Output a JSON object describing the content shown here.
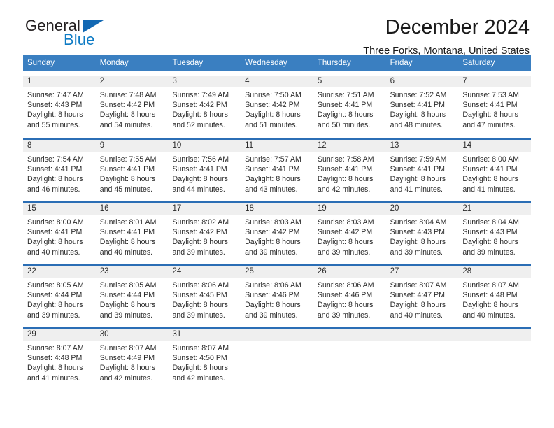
{
  "brand": {
    "name_top": "General",
    "name_bottom": "Blue",
    "accent_color": "#1268b3",
    "text_color": "#231f20"
  },
  "header": {
    "title": "December 2024",
    "subtitle": "Three Forks, Montana, United States"
  },
  "calendar": {
    "header_bg": "#3a7fc1",
    "row_border": "#2b6eb5",
    "daynum_bg": "#efefef",
    "weekdays": [
      "Sunday",
      "Monday",
      "Tuesday",
      "Wednesday",
      "Thursday",
      "Friday",
      "Saturday"
    ],
    "weeks": [
      [
        {
          "day": "1",
          "sunrise": "Sunrise: 7:47 AM",
          "sunset": "Sunset: 4:43 PM",
          "daylight1": "Daylight: 8 hours",
          "daylight2": "and 55 minutes."
        },
        {
          "day": "2",
          "sunrise": "Sunrise: 7:48 AM",
          "sunset": "Sunset: 4:42 PM",
          "daylight1": "Daylight: 8 hours",
          "daylight2": "and 54 minutes."
        },
        {
          "day": "3",
          "sunrise": "Sunrise: 7:49 AM",
          "sunset": "Sunset: 4:42 PM",
          "daylight1": "Daylight: 8 hours",
          "daylight2": "and 52 minutes."
        },
        {
          "day": "4",
          "sunrise": "Sunrise: 7:50 AM",
          "sunset": "Sunset: 4:42 PM",
          "daylight1": "Daylight: 8 hours",
          "daylight2": "and 51 minutes."
        },
        {
          "day": "5",
          "sunrise": "Sunrise: 7:51 AM",
          "sunset": "Sunset: 4:41 PM",
          "daylight1": "Daylight: 8 hours",
          "daylight2": "and 50 minutes."
        },
        {
          "day": "6",
          "sunrise": "Sunrise: 7:52 AM",
          "sunset": "Sunset: 4:41 PM",
          "daylight1": "Daylight: 8 hours",
          "daylight2": "and 48 minutes."
        },
        {
          "day": "7",
          "sunrise": "Sunrise: 7:53 AM",
          "sunset": "Sunset: 4:41 PM",
          "daylight1": "Daylight: 8 hours",
          "daylight2": "and 47 minutes."
        }
      ],
      [
        {
          "day": "8",
          "sunrise": "Sunrise: 7:54 AM",
          "sunset": "Sunset: 4:41 PM",
          "daylight1": "Daylight: 8 hours",
          "daylight2": "and 46 minutes."
        },
        {
          "day": "9",
          "sunrise": "Sunrise: 7:55 AM",
          "sunset": "Sunset: 4:41 PM",
          "daylight1": "Daylight: 8 hours",
          "daylight2": "and 45 minutes."
        },
        {
          "day": "10",
          "sunrise": "Sunrise: 7:56 AM",
          "sunset": "Sunset: 4:41 PM",
          "daylight1": "Daylight: 8 hours",
          "daylight2": "and 44 minutes."
        },
        {
          "day": "11",
          "sunrise": "Sunrise: 7:57 AM",
          "sunset": "Sunset: 4:41 PM",
          "daylight1": "Daylight: 8 hours",
          "daylight2": "and 43 minutes."
        },
        {
          "day": "12",
          "sunrise": "Sunrise: 7:58 AM",
          "sunset": "Sunset: 4:41 PM",
          "daylight1": "Daylight: 8 hours",
          "daylight2": "and 42 minutes."
        },
        {
          "day": "13",
          "sunrise": "Sunrise: 7:59 AM",
          "sunset": "Sunset: 4:41 PM",
          "daylight1": "Daylight: 8 hours",
          "daylight2": "and 41 minutes."
        },
        {
          "day": "14",
          "sunrise": "Sunrise: 8:00 AM",
          "sunset": "Sunset: 4:41 PM",
          "daylight1": "Daylight: 8 hours",
          "daylight2": "and 41 minutes."
        }
      ],
      [
        {
          "day": "15",
          "sunrise": "Sunrise: 8:00 AM",
          "sunset": "Sunset: 4:41 PM",
          "daylight1": "Daylight: 8 hours",
          "daylight2": "and 40 minutes."
        },
        {
          "day": "16",
          "sunrise": "Sunrise: 8:01 AM",
          "sunset": "Sunset: 4:41 PM",
          "daylight1": "Daylight: 8 hours",
          "daylight2": "and 40 minutes."
        },
        {
          "day": "17",
          "sunrise": "Sunrise: 8:02 AM",
          "sunset": "Sunset: 4:42 PM",
          "daylight1": "Daylight: 8 hours",
          "daylight2": "and 39 minutes."
        },
        {
          "day": "18",
          "sunrise": "Sunrise: 8:03 AM",
          "sunset": "Sunset: 4:42 PM",
          "daylight1": "Daylight: 8 hours",
          "daylight2": "and 39 minutes."
        },
        {
          "day": "19",
          "sunrise": "Sunrise: 8:03 AM",
          "sunset": "Sunset: 4:42 PM",
          "daylight1": "Daylight: 8 hours",
          "daylight2": "and 39 minutes."
        },
        {
          "day": "20",
          "sunrise": "Sunrise: 8:04 AM",
          "sunset": "Sunset: 4:43 PM",
          "daylight1": "Daylight: 8 hours",
          "daylight2": "and 39 minutes."
        },
        {
          "day": "21",
          "sunrise": "Sunrise: 8:04 AM",
          "sunset": "Sunset: 4:43 PM",
          "daylight1": "Daylight: 8 hours",
          "daylight2": "and 39 minutes."
        }
      ],
      [
        {
          "day": "22",
          "sunrise": "Sunrise: 8:05 AM",
          "sunset": "Sunset: 4:44 PM",
          "daylight1": "Daylight: 8 hours",
          "daylight2": "and 39 minutes."
        },
        {
          "day": "23",
          "sunrise": "Sunrise: 8:05 AM",
          "sunset": "Sunset: 4:44 PM",
          "daylight1": "Daylight: 8 hours",
          "daylight2": "and 39 minutes."
        },
        {
          "day": "24",
          "sunrise": "Sunrise: 8:06 AM",
          "sunset": "Sunset: 4:45 PM",
          "daylight1": "Daylight: 8 hours",
          "daylight2": "and 39 minutes."
        },
        {
          "day": "25",
          "sunrise": "Sunrise: 8:06 AM",
          "sunset": "Sunset: 4:46 PM",
          "daylight1": "Daylight: 8 hours",
          "daylight2": "and 39 minutes."
        },
        {
          "day": "26",
          "sunrise": "Sunrise: 8:06 AM",
          "sunset": "Sunset: 4:46 PM",
          "daylight1": "Daylight: 8 hours",
          "daylight2": "and 39 minutes."
        },
        {
          "day": "27",
          "sunrise": "Sunrise: 8:07 AM",
          "sunset": "Sunset: 4:47 PM",
          "daylight1": "Daylight: 8 hours",
          "daylight2": "and 40 minutes."
        },
        {
          "day": "28",
          "sunrise": "Sunrise: 8:07 AM",
          "sunset": "Sunset: 4:48 PM",
          "daylight1": "Daylight: 8 hours",
          "daylight2": "and 40 minutes."
        }
      ],
      [
        {
          "day": "29",
          "sunrise": "Sunrise: 8:07 AM",
          "sunset": "Sunset: 4:48 PM",
          "daylight1": "Daylight: 8 hours",
          "daylight2": "and 41 minutes."
        },
        {
          "day": "30",
          "sunrise": "Sunrise: 8:07 AM",
          "sunset": "Sunset: 4:49 PM",
          "daylight1": "Daylight: 8 hours",
          "daylight2": "and 42 minutes."
        },
        {
          "day": "31",
          "sunrise": "Sunrise: 8:07 AM",
          "sunset": "Sunset: 4:50 PM",
          "daylight1": "Daylight: 8 hours",
          "daylight2": "and 42 minutes."
        },
        {
          "day": "",
          "sunrise": "",
          "sunset": "",
          "daylight1": "",
          "daylight2": ""
        },
        {
          "day": "",
          "sunrise": "",
          "sunset": "",
          "daylight1": "",
          "daylight2": ""
        },
        {
          "day": "",
          "sunrise": "",
          "sunset": "",
          "daylight1": "",
          "daylight2": ""
        },
        {
          "day": "",
          "sunrise": "",
          "sunset": "",
          "daylight1": "",
          "daylight2": ""
        }
      ]
    ]
  }
}
